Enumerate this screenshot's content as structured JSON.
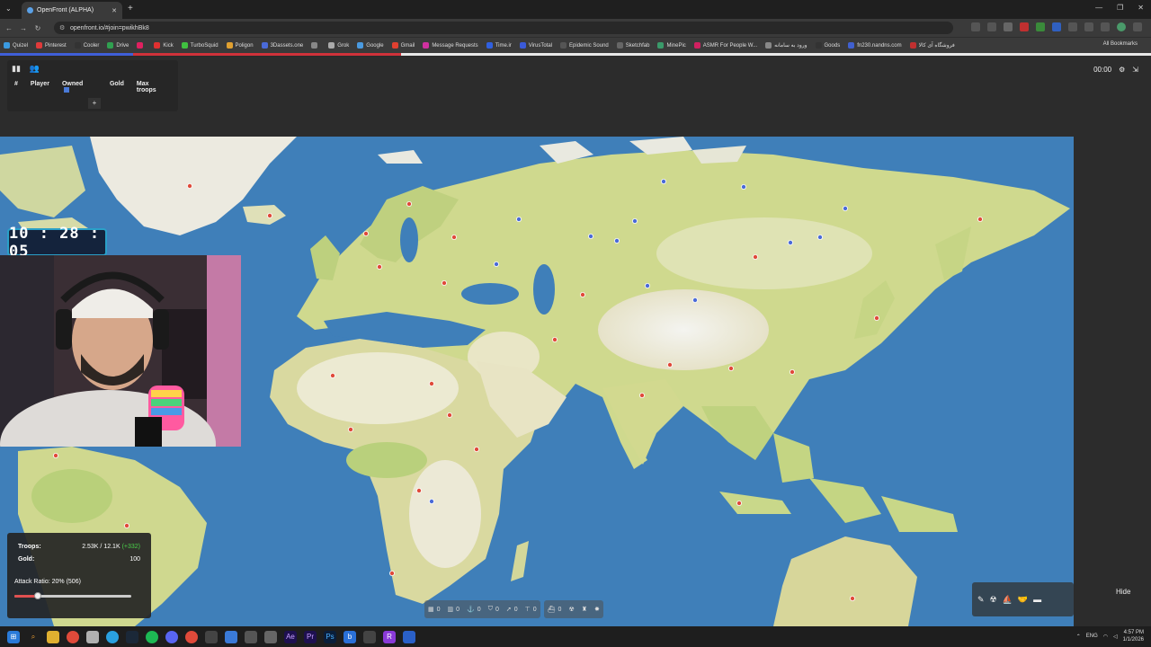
{
  "browser": {
    "tab_title": "OpenFront (ALPHA)",
    "url": "openfront.io/#join=pwikhBk8",
    "bookmarks": [
      "Quizel",
      "Pinterest",
      "Cooler",
      "Drive",
      "",
      "Kick",
      "TurboSquid",
      "Poligon",
      "3Dassets.one",
      "",
      "Grok",
      "Google",
      "Gmail",
      "Message Requests",
      "Time.ir",
      "VirusTotal",
      "Epidemic Sound",
      "Sketchfab",
      "MinePic",
      "ASMR For People W...",
      "ورود به سامانه",
      "Goods",
      "fn230.nandns.com",
      "فروشگاه آی کالا"
    ],
    "all_bookmarks": "All Bookmarks"
  },
  "leaderboard": {
    "columns": [
      "#",
      "Player",
      "Owned",
      "Gold",
      "Max troops"
    ],
    "add": "+"
  },
  "game_timer": "00:00",
  "overlay_timer": "10 : 28 : 05",
  "stats": {
    "troops_label": "Troops:",
    "troops_value": "2.53K / 12.1K",
    "troops_delta": "(+332)",
    "gold_label": "Gold:",
    "gold_value": "100",
    "attack_ratio": "Attack Ratio: 20% (506)",
    "attack_ratio_fraction": 0.2
  },
  "build_bar": [
    "0",
    "0",
    "0",
    "0",
    "0",
    "0",
    "0"
  ],
  "hide_label": "Hide",
  "taskbar": {
    "lang": "ENG",
    "time": "4:57 PM",
    "date": "1/1/2026"
  }
}
